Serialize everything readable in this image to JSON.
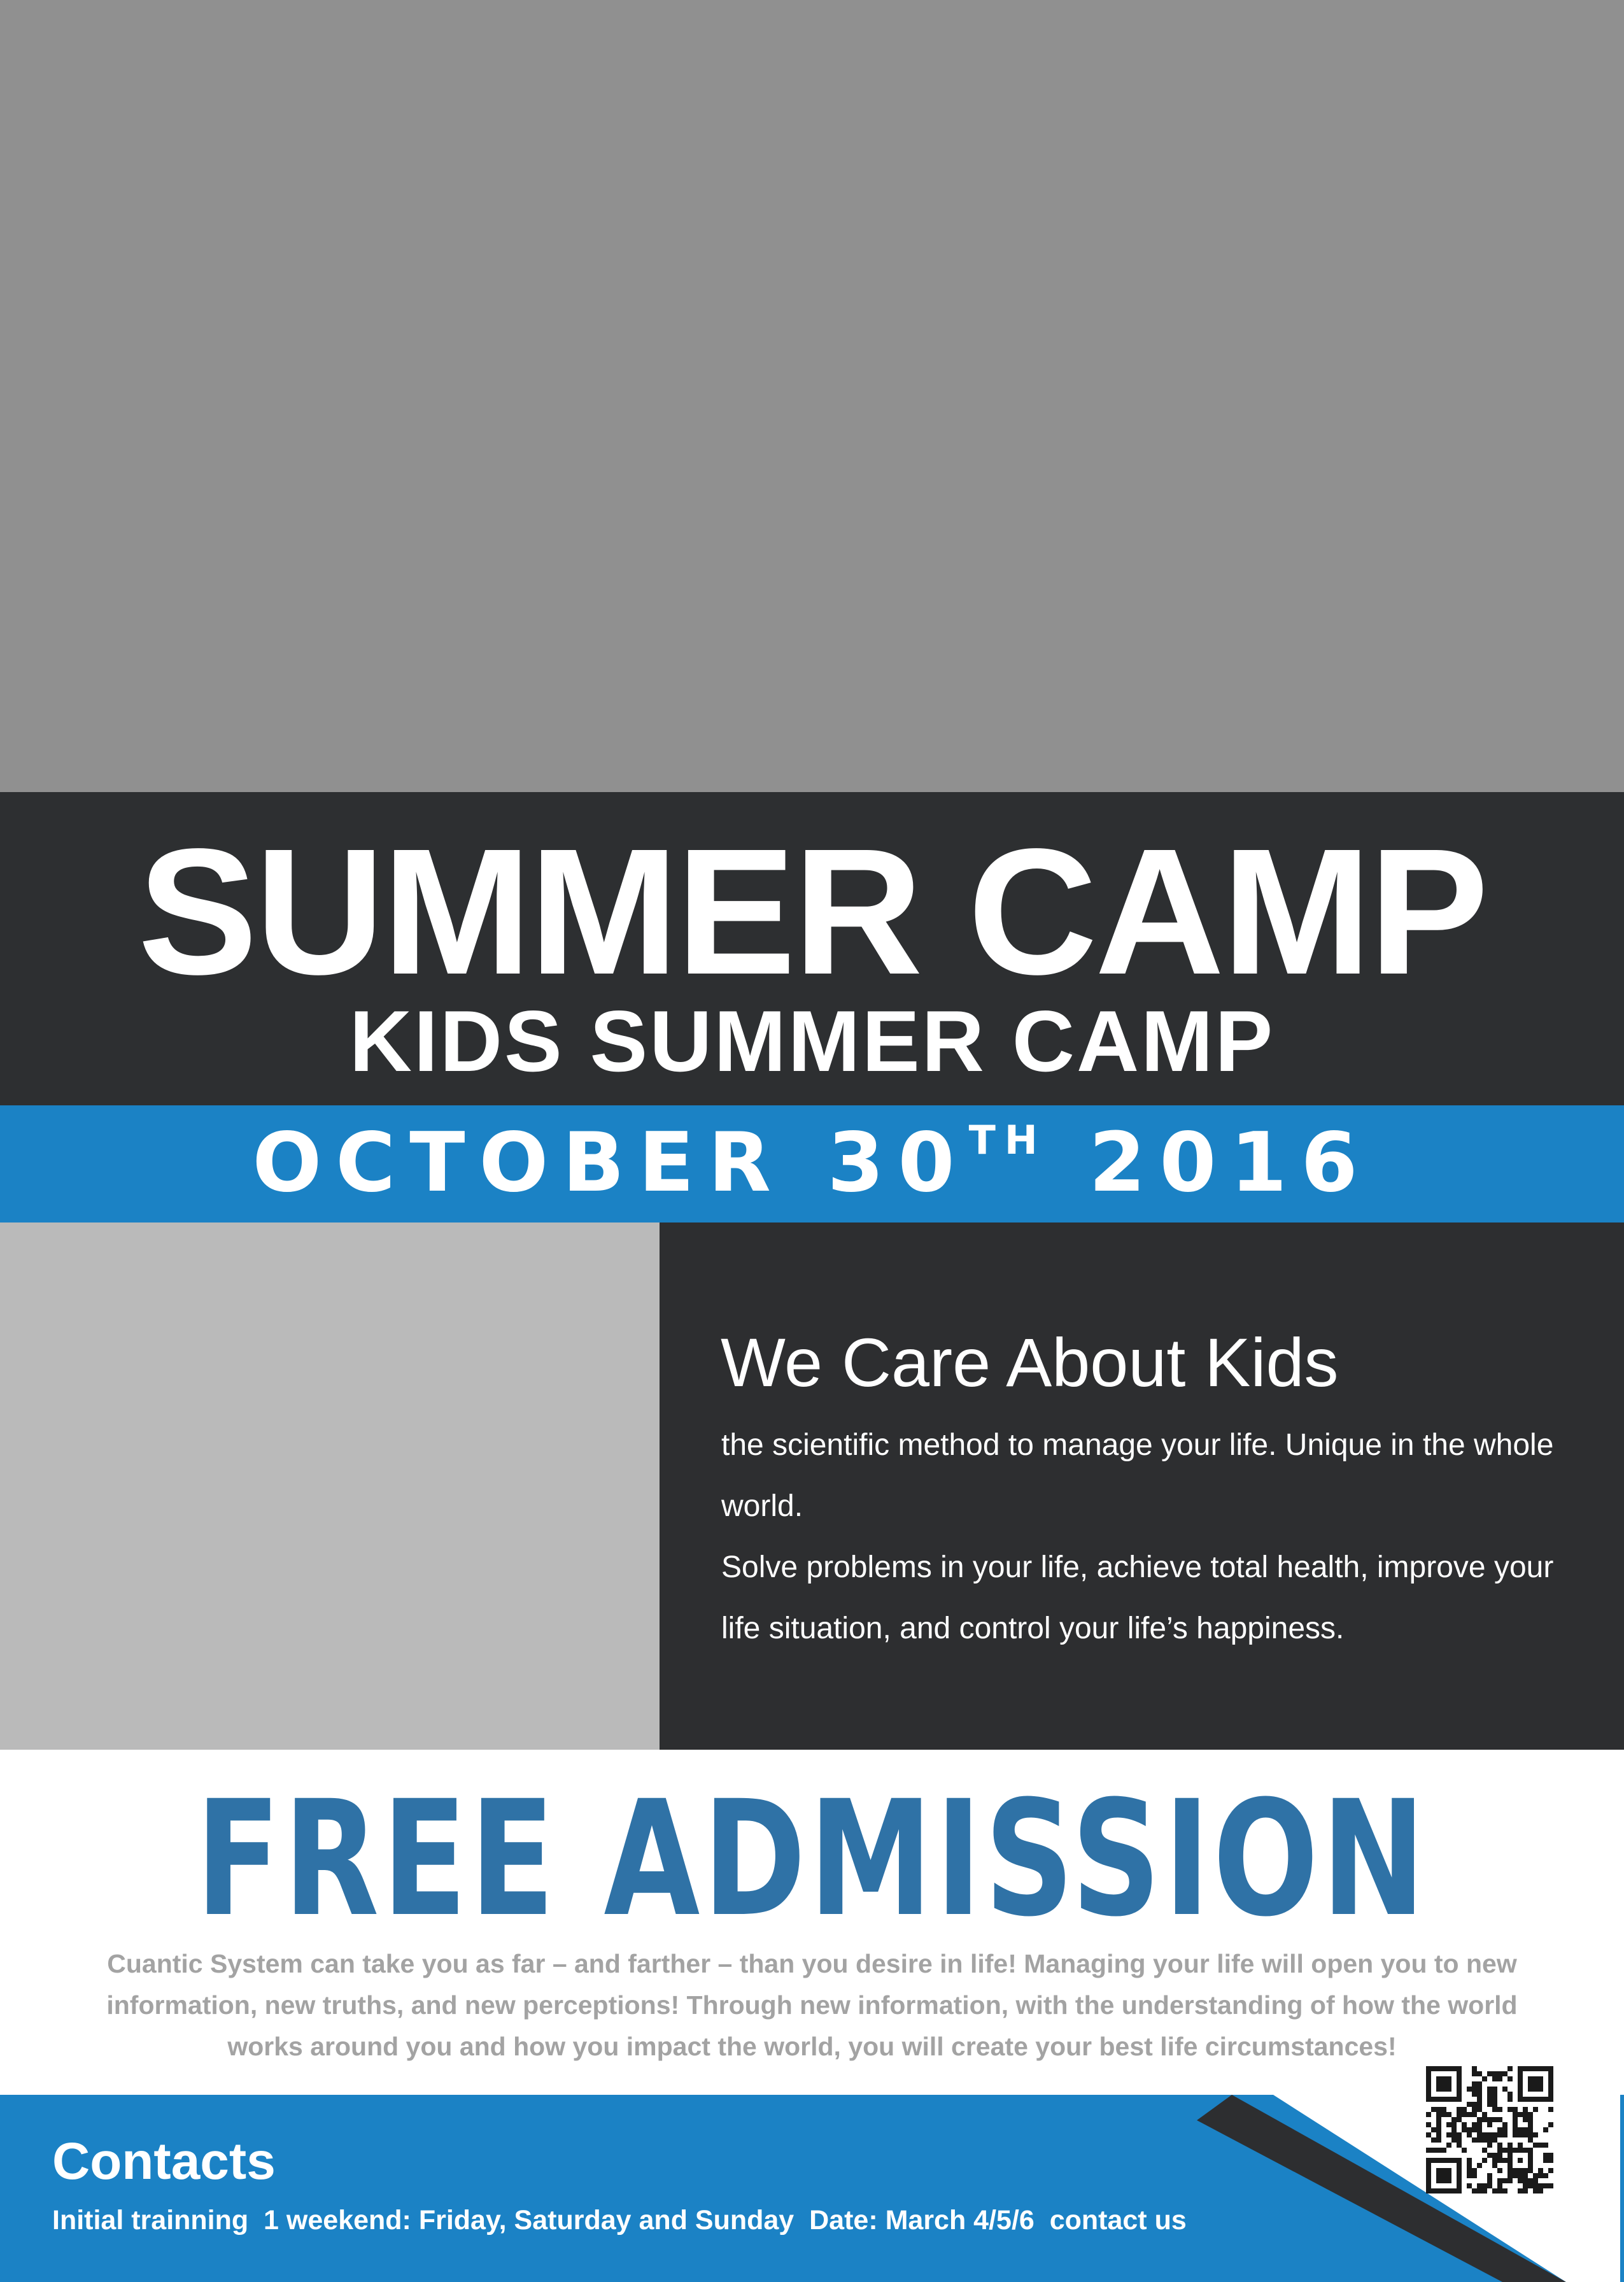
{
  "poster": {
    "title": "SUMMER CAMP",
    "subtitle": "KIDS SUMMER CAMP",
    "date": {
      "month": "OCTOBER",
      "day": "30",
      "suffix": "TH",
      "year": "2016"
    }
  },
  "about": {
    "heading": "We Care About Kids",
    "paragraph_1": "the scientific method to manage your life. Unique in the whole world.",
    "paragraph_2": "Solve problems in your life, achieve total health, improve your life situation, and control your life’s happiness."
  },
  "admission": {
    "heading": "FREE ADMISSION",
    "text": "Cuantic System can take you as far – and farther – than you desire in life! Managing your life will open you to new information, new truths, and new perceptions! Through new information, with the understanding of how the world works around you and how you impact the world, you will create your best life circumstances!"
  },
  "contacts": {
    "heading": "Contacts",
    "details": "Initial trainning  1 weekend: Friday, Saturday and Sunday  Date: March 4/5/6  contact us"
  },
  "colors": {
    "dark_band": "#2d2f31",
    "accent_blue": "#1b82c5",
    "heading_blue": "#2f72a6",
    "body_gray": "#a3a3a3",
    "hero_placeholder": "#909090",
    "side_placeholder": "#bababa"
  },
  "icons": {
    "qr": "qr-code-icon"
  }
}
